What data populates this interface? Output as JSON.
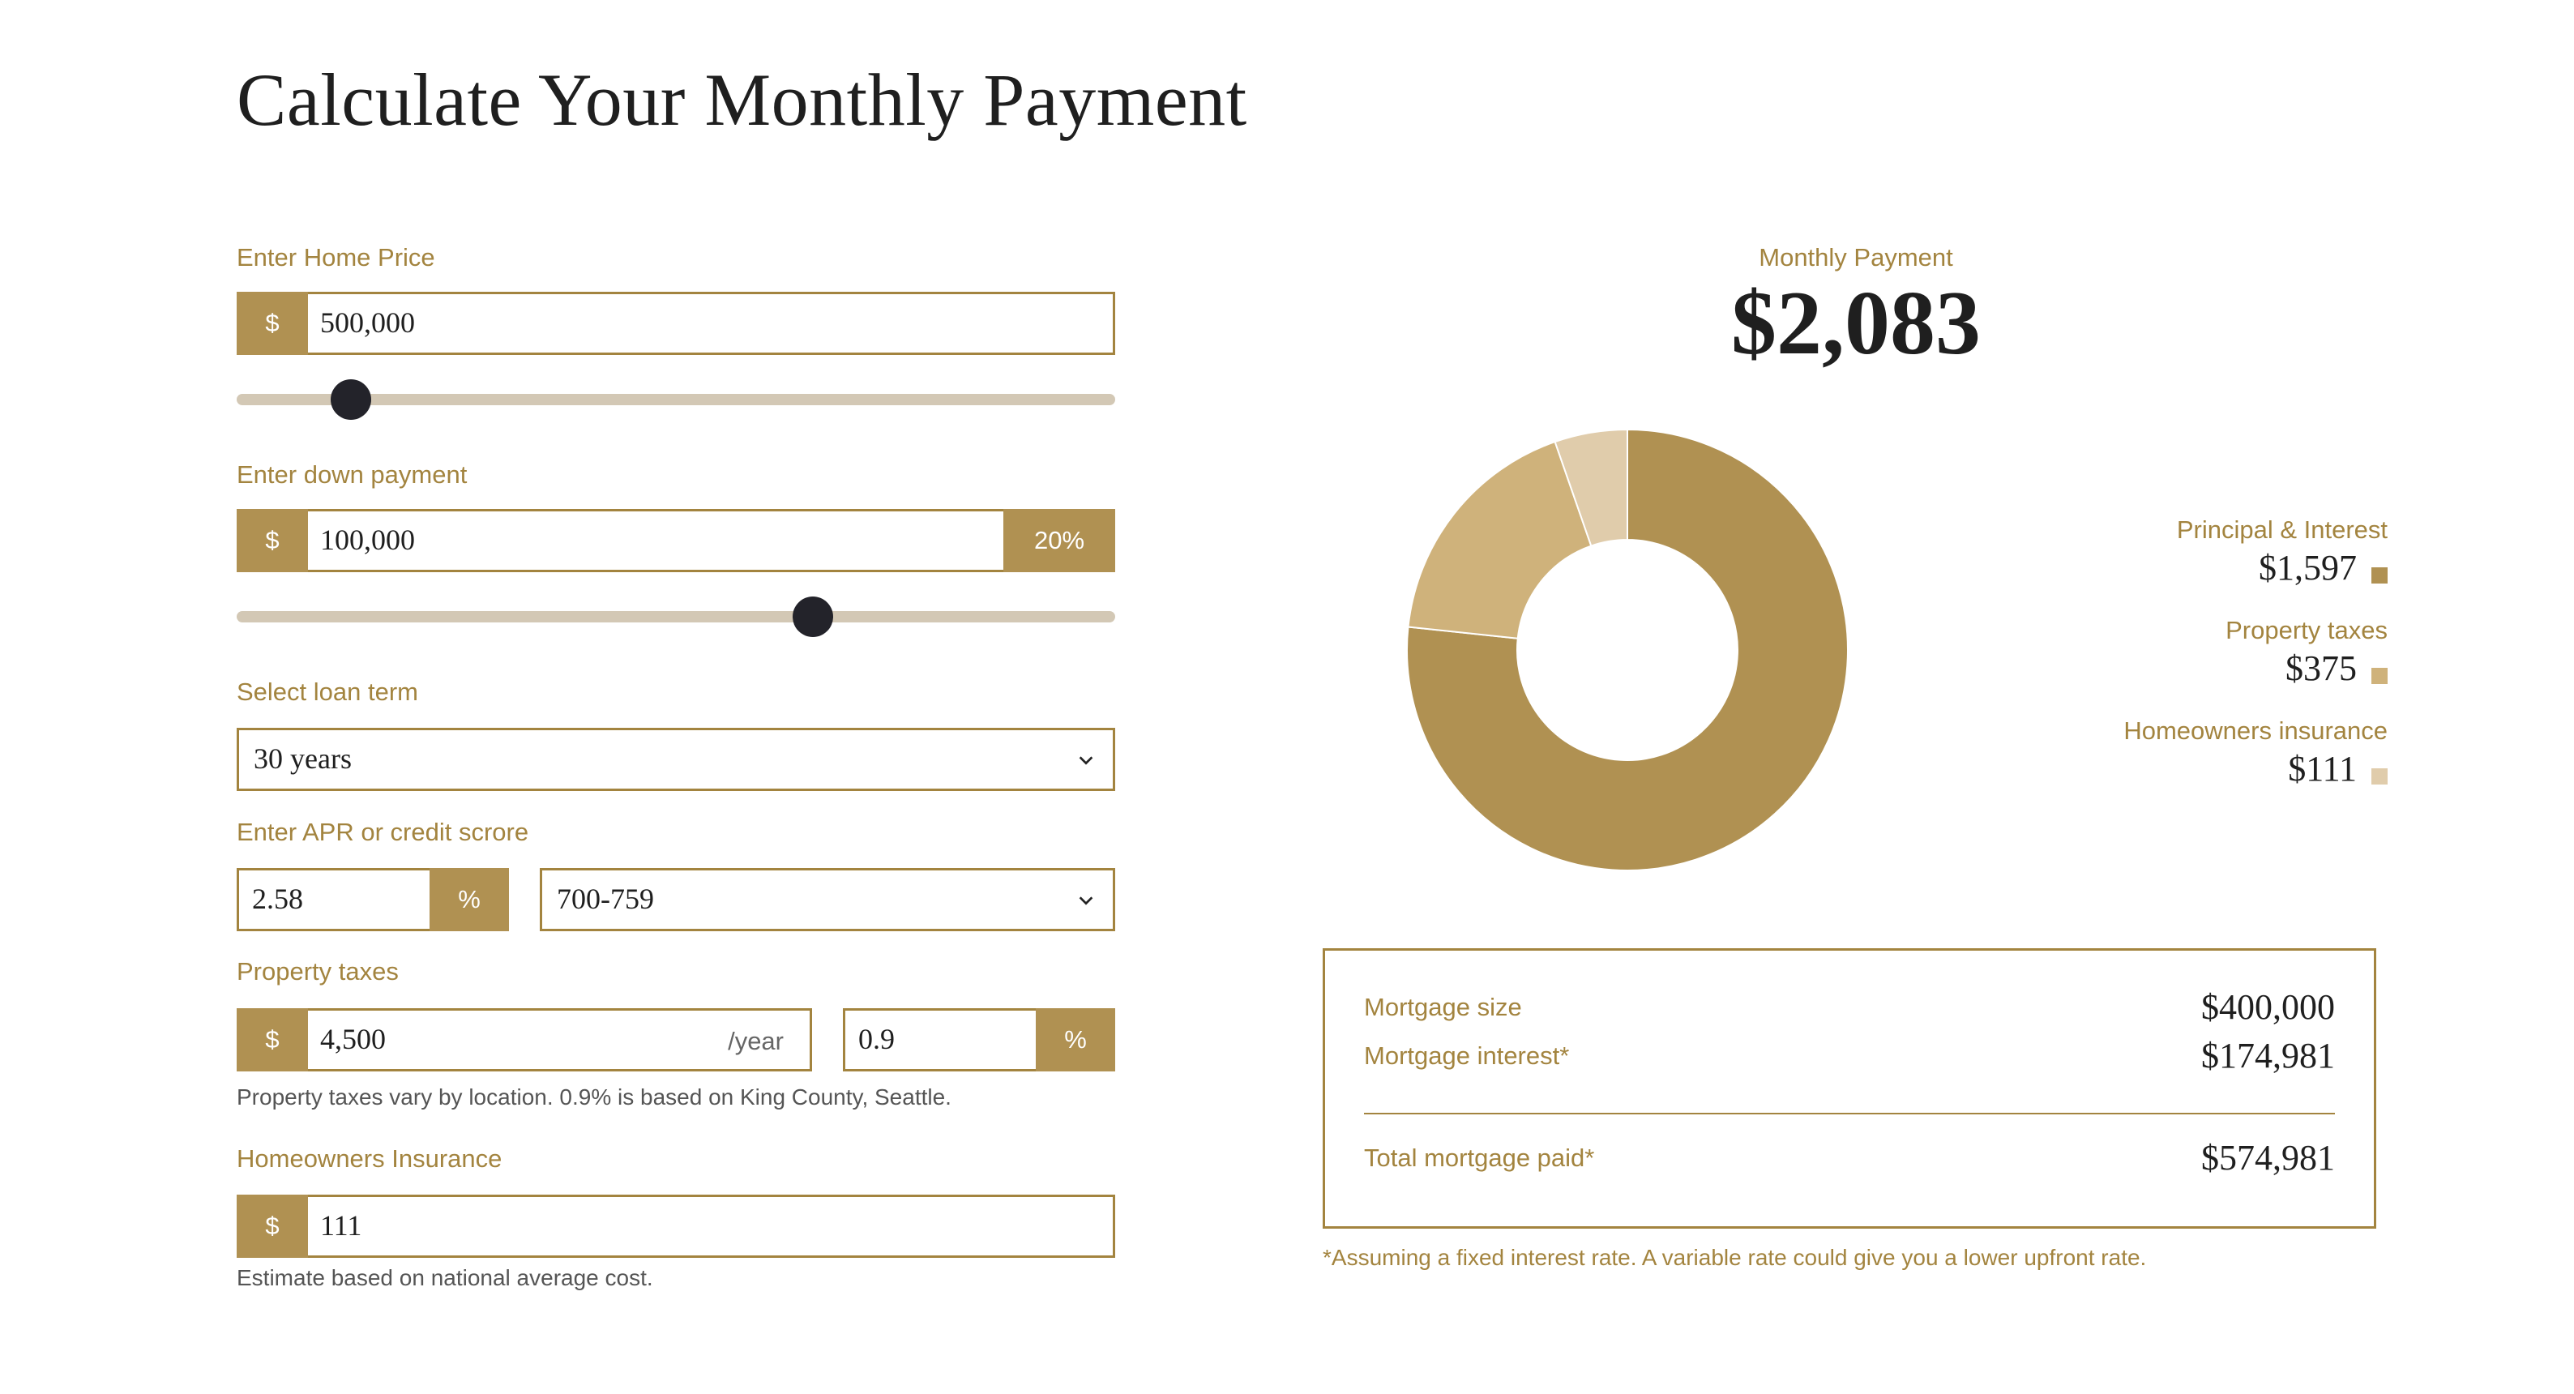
{
  "title": "Calculate Your Monthly Payment",
  "home_price": {
    "label": "Enter Home Price",
    "currency": "$",
    "value": "500,000",
    "slider_fraction": 0.13
  },
  "down_payment": {
    "label": "Enter down payment",
    "currency": "$",
    "value": "100,000",
    "percent": "20%",
    "slider_fraction": 0.656
  },
  "loan_term": {
    "label": "Select loan term",
    "selected": "30 years"
  },
  "apr": {
    "label": "Enter APR or credit scrore",
    "value": "2.58",
    "unit": "%",
    "credit_score_selected": "700-759"
  },
  "property_taxes": {
    "label": "Property taxes",
    "currency": "$",
    "value": "4,500",
    "period": "/year",
    "rate": "0.9",
    "rate_unit": "%",
    "note": "Property taxes vary by location. 0.9% is based on King County, Seattle."
  },
  "insurance": {
    "label": "Homeowners Insurance",
    "currency": "$",
    "value": "111",
    "note": "Estimate based on national average cost."
  },
  "monthly": {
    "label": "Monthly Payment",
    "value": "$2,083"
  },
  "chart_data": {
    "type": "pie",
    "donut": true,
    "categories": [
      "Principal & Interest",
      "Property taxes",
      "Homeowners insurance"
    ],
    "values": [
      1597,
      375,
      111
    ],
    "display_values": [
      "$1,597",
      "$375",
      "$111"
    ],
    "colors": [
      "#b09152",
      "#cfb27b",
      "#e0ccab"
    ],
    "legend_position": "right"
  },
  "summary": {
    "mortgage_size_label": "Mortgage size",
    "mortgage_size_value": "$400,000",
    "mortgage_interest_label": "Mortgage interest*",
    "mortgage_interest_value": "$174,981",
    "total_label": "Total mortgage paid*",
    "total_value": "$574,981",
    "footnote": "*Assuming a fixed interest rate. A variable rate could give you a lower upfront rate."
  },
  "icons": {
    "dropdown": "chevron-down-icon"
  }
}
